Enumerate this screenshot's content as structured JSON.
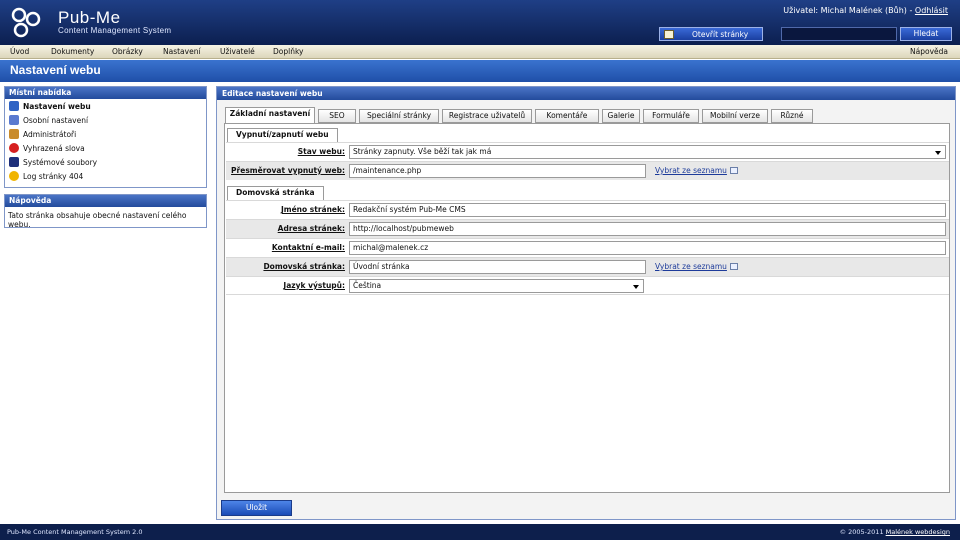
{
  "header": {
    "title": "Pub-Me",
    "subtitle": "Content Management System",
    "user_label": "Uživatel: Michal Malének (Bůh) - ",
    "logout": "Odhlásit",
    "open_site": "Otevřít stránky",
    "search_button": "Hledat"
  },
  "menu": {
    "items": [
      "Úvod",
      "Dokumenty",
      "Obrázky",
      "Nastavení",
      "Uživatelé",
      "Doplňky"
    ],
    "help": "Nápověda"
  },
  "page": {
    "title": "Nastavení webu"
  },
  "sidebar": {
    "local_menu_title": "Místní nabídka",
    "items": [
      {
        "label": "Nastavení webu",
        "icon": "settings-edit-icon"
      },
      {
        "label": "Osobní nastavení",
        "icon": "personal-settings-icon"
      },
      {
        "label": "Administrátoři",
        "icon": "administrators-icon"
      },
      {
        "label": "Vyhrazená slova",
        "icon": "forbidden-icon"
      },
      {
        "label": "Systémové soubory",
        "icon": "floppy-disk-icon"
      },
      {
        "label": "Log stránky 404",
        "icon": "warning-icon"
      }
    ],
    "help_title": "Nápověda",
    "help_text": "Tato stránka obsahuje obecné nastavení celého webu."
  },
  "main": {
    "title": "Editace nastavení webu",
    "tabs": [
      "Základní nastavení",
      "SEO",
      "Speciální stránky",
      "Registrace uživatelů",
      "Komentáře",
      "Galerie",
      "Formuláře",
      "Mobilní verze",
      "Různé"
    ],
    "active_tab": 0,
    "section1_title": "Vypnutí/zapnutí webu",
    "section2_title": "Domovská stránka",
    "fields": {
      "stav_label": "Stav webu:",
      "stav_value": "Stránky zapnuty. Vše běží tak jak má",
      "redirect_label": "Přesměrovat vypnutý web:",
      "redirect_value": "/maintenance.php",
      "pick_link": "Vybrat ze seznamu",
      "name_label": "Jméno stránek:",
      "name_value": "Redakční systém Pub-Me CMS",
      "address_label": "Adresa stránek:",
      "address_value": "http://localhost/pubmeweb",
      "email_label": "Kontaktní e-mail:",
      "email_value": "michal@malenek.cz",
      "home_label": "Domovská stránka:",
      "home_value": "Úvodní stránka",
      "lang_label": "Jazyk výstupů:",
      "lang_value": "Čeština"
    },
    "save_button": "Uložit"
  },
  "footer": {
    "left": "Pub-Me Content Management System 2.0",
    "right_text": "© 2005-2011 ",
    "right_link": "Malének webdesign"
  },
  "colors": {
    "header": "#0c1f4f",
    "accent": "#1f4fa8",
    "menubar": "#e8e3cc"
  }
}
